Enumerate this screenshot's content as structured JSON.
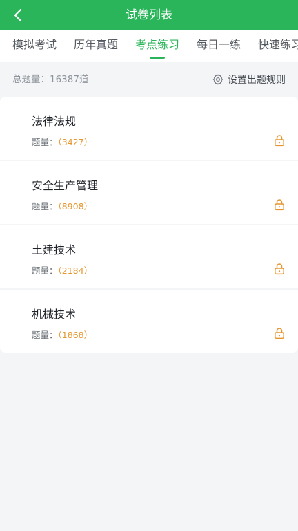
{
  "header": {
    "title": "试卷列表",
    "back_icon": "chevron-left-icon",
    "bg_color": "#2bb55a"
  },
  "tabs": [
    {
      "label": "模拟考试",
      "active": false
    },
    {
      "label": "历年真题",
      "active": false
    },
    {
      "label": "考点练习",
      "active": true
    },
    {
      "label": "每日一练",
      "active": false
    },
    {
      "label": "快速练习",
      "active": false
    }
  ],
  "summary": {
    "total_text": "总题量：16387道",
    "rules_label": "设置出题规则",
    "rules_icon": "gear-icon"
  },
  "papers": [
    {
      "title": "法律法规",
      "count_label": "题量：",
      "count": "（3427）",
      "locked": true
    },
    {
      "title": "安全生产管理",
      "count_label": "题量：",
      "count": "（8908）",
      "locked": true
    },
    {
      "title": "土建技术",
      "count_label": "题量：",
      "count": "（2184）",
      "locked": true
    },
    {
      "title": "机械技术",
      "count_label": "题量：",
      "count": "（1868）",
      "locked": true
    }
  ],
  "colors": {
    "accent": "#2bb55a",
    "count": "#e6962e",
    "lock": "#e6962e"
  }
}
